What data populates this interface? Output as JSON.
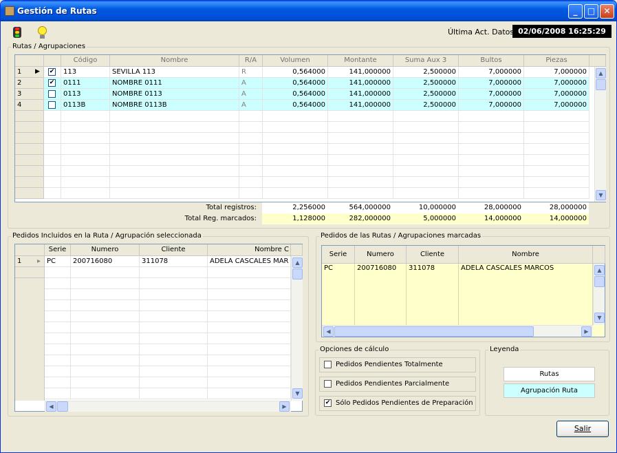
{
  "window": {
    "title": "Gestión de Rutas",
    "minimize": "_",
    "maximize": "□",
    "close": "✕"
  },
  "toolbar": {
    "semaphore_icon": "traffic-light-icon",
    "bulb_icon": "light-bulb-icon",
    "last_update_label": "Última Act. Datos:",
    "last_update_value": "02/06/2008 16:25:29"
  },
  "rutas": {
    "title": "Rutas / Agrupaciones",
    "columns": [
      "Código",
      "Nombre",
      "R/A",
      "Volumen",
      "Montante",
      "Suma Aux 3",
      "Bultos",
      "Piezas"
    ],
    "rows": [
      {
        "idx": "1",
        "checked": true,
        "codigo": "113",
        "nombre": "SEVILLA 113",
        "ra": "R",
        "volumen": "0,564000",
        "montante": "141,000000",
        "suma": "2,500000",
        "bultos": "7,000000",
        "piezas": "7,000000"
      },
      {
        "idx": "2",
        "checked": true,
        "codigo": "0111",
        "nombre": "NOMBRE 0111",
        "ra": "A",
        "volumen": "0,564000",
        "montante": "141,000000",
        "suma": "2,500000",
        "bultos": "7,000000",
        "piezas": "7,000000"
      },
      {
        "idx": "3",
        "checked": false,
        "codigo": "0113",
        "nombre": "NOMBRE 0113",
        "ra": "A",
        "volumen": "0,564000",
        "montante": "141,000000",
        "suma": "2,500000",
        "bultos": "7,000000",
        "piezas": "7,000000"
      },
      {
        "idx": "4",
        "checked": false,
        "codigo": "0113B",
        "nombre": "NOMBRE 0113B",
        "ra": "A",
        "volumen": "0,564000",
        "montante": "141,000000",
        "suma": "2,500000",
        "bultos": "7,000000",
        "piezas": "7,000000"
      }
    ],
    "total_label": "Total registros:",
    "total": [
      "2,256000",
      "564,000000",
      "10,000000",
      "28,000000",
      "28,000000"
    ],
    "marked_label": "Total Reg. marcados:",
    "marked": [
      "1,128000",
      "282,000000",
      "5,000000",
      "14,000000",
      "14,000000"
    ]
  },
  "pedidos_sel": {
    "title": "Pedidos Incluidos en la Ruta / Agrupación seleccionada",
    "columns": [
      "Serie",
      "Numero",
      "Cliente",
      "Nombre C"
    ],
    "rows": [
      {
        "idx": "1",
        "serie": "PC",
        "numero": "200716080",
        "cliente": "311078",
        "nombre": "ADELA CASCALES MAR"
      }
    ]
  },
  "pedidos_marc": {
    "title": "Pedidos de las Rutas / Agrupaciones marcadas",
    "columns": [
      "Serie",
      "Numero",
      "Cliente",
      "Nombre"
    ],
    "rows": [
      {
        "serie": "PC",
        "numero": "200716080",
        "cliente": "311078",
        "nombre": "ADELA CASCALES MARCOS"
      }
    ]
  },
  "opciones": {
    "title": "Opciones de cálculo",
    "items": [
      {
        "label": "Pedidos Pendientes Totalmente",
        "checked": false
      },
      {
        "label": "Pedidos Pendientes Parcialmente",
        "checked": false
      },
      {
        "label": "Sólo Pedidos Pendientes de Preparación",
        "checked": true
      }
    ]
  },
  "leyenda": {
    "title": "Leyenda",
    "rutas": "Rutas",
    "agrupacion": "Agrupación Ruta"
  },
  "salir": "Salir",
  "colors": {
    "agrupacion_row": "#ccffff",
    "marked_total": "#ffffcc",
    "pedidos_marc_bg": "#ffffcc"
  }
}
